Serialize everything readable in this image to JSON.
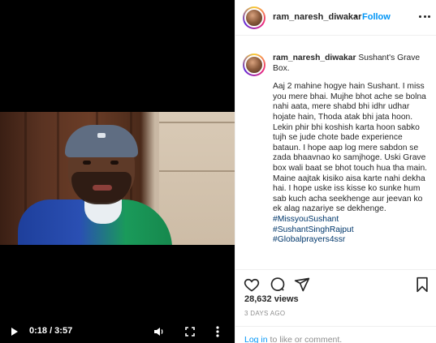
{
  "video": {
    "time_display": "0:18 / 3:57",
    "icons": [
      "play-icon",
      "volume-icon",
      "fullscreen-icon",
      "more-vertical-icon"
    ]
  },
  "post": {
    "username": "ram_naresh_diwakar",
    "dot": "•",
    "follow_label": "Follow",
    "caption_title": "Sushant's Grave Box.",
    "caption_body": "Aaj 2 mahine hogye hain Sushant. I miss you mere bhai. Mujhe bhot ache se bolna nahi aata, mere shabd bhi idhr udhar hojate hain, Thoda atak bhi jata hoon. Lekin phir bhi koshish karta hoon sabko tujh se jude chote bade experience bataun. I hope aap log mere sabdon se zada bhaavnao ko samjhoge. Uski Grave box wali baat se bhot touch hua tha main. Maine aajtak kisiko aisa karte nahi dekha hai. I hope uske iss kisse ko sunke hum sab kuch acha seekhenge aur jeevan ko ek alag nazariye se dekhenge.",
    "hashtags": [
      "#MissyouSushant",
      "#SushantSinghRajput",
      "#Globalprayers4ssr"
    ],
    "views": "28,632 views",
    "date": "3 DAYS AGO",
    "login_link": "Log in",
    "login_rest": " to like or comment."
  }
}
